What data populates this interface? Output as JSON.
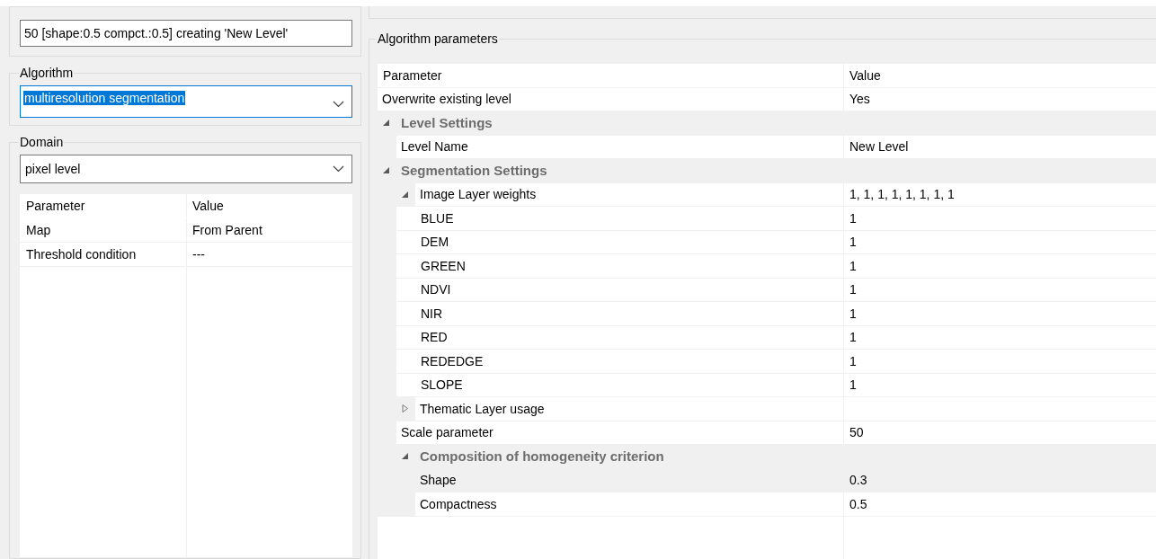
{
  "task_field": {
    "value": "50 [shape:0.5 compct.:0.5] creating 'New Level'"
  },
  "algorithm": {
    "label": "Algorithm",
    "value": "multiresolution segmentation",
    "focused": true
  },
  "domain": {
    "label": "Domain",
    "value": "pixel level",
    "focused": false,
    "table": {
      "columns": [
        "Parameter",
        "Value"
      ],
      "rows": [
        {
          "parameter": "Map",
          "value": "From Parent"
        },
        {
          "parameter": "Threshold condition",
          "value": "---"
        }
      ]
    }
  },
  "parameters": {
    "label": "Algorithm parameters",
    "columns": [
      "Parameter",
      "Value"
    ],
    "rows": [
      {
        "kind": "property",
        "name": "Overwrite existing level",
        "value": "Yes",
        "selected": false
      },
      {
        "kind": "category",
        "name": "Level Settings",
        "expanded": true,
        "selected": false,
        "children": [
          {
            "kind": "property",
            "name": "Level Name",
            "value": "New Level",
            "selected": false
          }
        ]
      },
      {
        "kind": "category",
        "name": "Segmentation Settings",
        "expanded": true,
        "selected": false,
        "children": [
          {
            "kind": "property",
            "name": "Image Layer weights",
            "value": "1, 1, 1, 1, 1, 1, 1, 1",
            "expanded": true,
            "selected": false,
            "children": [
              {
                "kind": "property",
                "name": "BLUE",
                "value": "1",
                "selected": false
              },
              {
                "kind": "property",
                "name": "DEM",
                "value": "1",
                "selected": false
              },
              {
                "kind": "property",
                "name": "GREEN",
                "value": "1",
                "selected": false
              },
              {
                "kind": "property",
                "name": "NDVI",
                "value": "1",
                "selected": false
              },
              {
                "kind": "property",
                "name": "NIR",
                "value": "1",
                "selected": false
              },
              {
                "kind": "property",
                "name": "RED",
                "value": "1",
                "selected": false
              },
              {
                "kind": "property",
                "name": "REDEDGE",
                "value": "1",
                "selected": false
              },
              {
                "kind": "property",
                "name": "SLOPE",
                "value": "1",
                "selected": false
              }
            ]
          },
          {
            "kind": "property",
            "name": "Thematic Layer usage",
            "expanded": false,
            "selected": false
          },
          {
            "kind": "property",
            "name": "Scale parameter",
            "value": "50",
            "selected": false
          },
          {
            "kind": "category",
            "name": "Composition of homogeneity criterion",
            "expanded": true,
            "selected": false,
            "children": [
              {
                "kind": "property",
                "name": "Shape",
                "value": "0.3",
                "selected": true
              },
              {
                "kind": "property",
                "name": "Compactness",
                "value": "0.5",
                "selected": false
              }
            ]
          }
        ]
      }
    ]
  }
}
